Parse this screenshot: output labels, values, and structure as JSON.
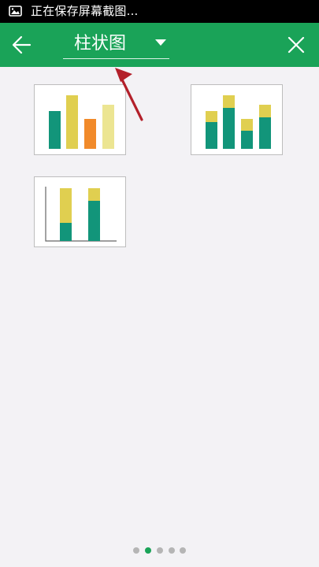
{
  "status_bar": {
    "text": "正在保存屏幕截图...",
    "icon": "image-icon"
  },
  "app_bar": {
    "title": "柱状图",
    "back_icon": "arrow-left-icon",
    "dropdown_icon": "caret-down-icon",
    "close_icon": "close-icon",
    "background": "#1aa358"
  },
  "chart_types": [
    {
      "id": "clustered-column",
      "icon": "clustered-column-chart-icon",
      "colors": [
        "#12957a",
        "#e0cf50",
        "#f18a2a",
        "#ece592"
      ]
    },
    {
      "id": "stacked-column",
      "icon": "stacked-column-chart-icon",
      "colors": [
        "#12957a",
        "#e0cf50"
      ]
    },
    {
      "id": "percent-stacked-column",
      "icon": "percent-stacked-column-chart-icon",
      "colors": [
        "#12957a",
        "#e0cf50"
      ]
    }
  ],
  "pager": {
    "count": 5,
    "active_page": 2,
    "active_color": "#1aa358",
    "inactive_color": "#b5b5b5"
  },
  "annotation": {
    "icon": "red-arrow-icon",
    "color": "#b3202a"
  }
}
